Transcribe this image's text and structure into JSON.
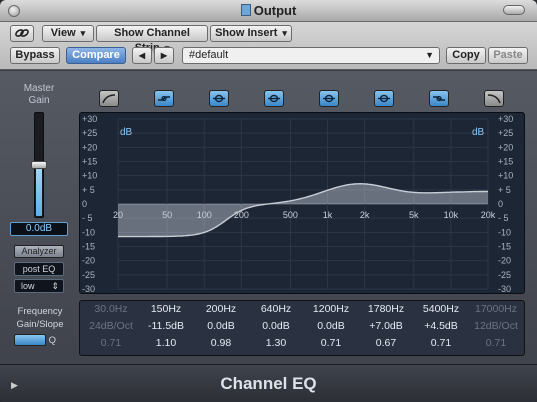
{
  "window": {
    "title": "Output"
  },
  "toolbar": {
    "view": "View",
    "channel_strip": "Show Channel Strip",
    "insert": "Show Insert",
    "bypass": "Bypass",
    "compare": "Compare",
    "prev": "◀",
    "next": "▶",
    "preset": "#default",
    "copy": "Copy",
    "paste": "Paste"
  },
  "left": {
    "master_gain_label": "Master\nGain",
    "gain_value": "0.0dB",
    "gain_level": 0.5,
    "analyzer": "Analyzer",
    "analyzer_mode": "post EQ",
    "resolution": "low"
  },
  "display": {
    "db_label": "dB",
    "db_ticks": [
      "+30",
      "+25",
      "+20",
      "+15",
      "+10",
      "+ 5",
      "0",
      "- 5",
      "-10",
      "-15",
      "-20",
      "-25",
      "-30"
    ],
    "freq_ticks": [
      "20",
      "50",
      "100",
      "200",
      "500",
      "1k",
      "2k",
      "5k",
      "10k",
      "20k"
    ],
    "curve_color": "#c8cdd6"
  },
  "params": {
    "labels": [
      "Frequency",
      "Gain/Slope",
      "Q"
    ],
    "bands": [
      {
        "freq": "30.0Hz",
        "gain": "24dB/Oct",
        "q": "0.71",
        "active": false
      },
      {
        "freq": "150Hz",
        "gain": "-11.5dB",
        "q": "1.10",
        "active": true
      },
      {
        "freq": "200Hz",
        "gain": "0.0dB",
        "q": "0.98",
        "active": true
      },
      {
        "freq": "640Hz",
        "gain": "0.0dB",
        "q": "1.30",
        "active": true
      },
      {
        "freq": "1200Hz",
        "gain": "0.0dB",
        "q": "0.71",
        "active": true
      },
      {
        "freq": "1780Hz",
        "gain": "+7.0dB",
        "q": "0.67",
        "active": true
      },
      {
        "freq": "5400Hz",
        "gain": "+4.5dB",
        "q": "0.71",
        "active": true
      },
      {
        "freq": "17000Hz",
        "gain": "12dB/Oct",
        "q": "0.71",
        "active": false
      }
    ]
  },
  "footer": {
    "name": "Channel EQ"
  },
  "colors": {
    "accent": "#4b86c6",
    "readout": "#8fd0ff"
  }
}
